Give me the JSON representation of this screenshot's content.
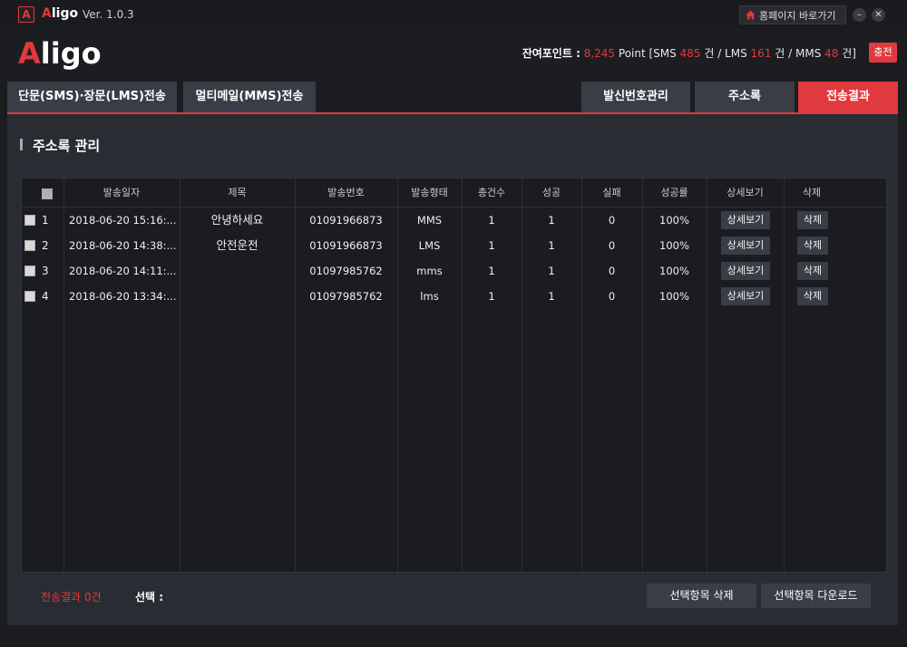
{
  "window": {
    "app_name_a": "A",
    "app_name_rest": "ligo",
    "version": "Ver. 1.0.3",
    "home_label": "홈페이지 바로가기",
    "minimize": "–",
    "close": "✕"
  },
  "header": {
    "logo_a": "A",
    "logo_rest": "ligo",
    "points_label": "잔여포인트 :",
    "points_value": "8,245",
    "points_unit": "Point [SMS",
    "sms_count": "485",
    "sms_unit": "건 / LMS",
    "lms_count": "161",
    "lms_unit": "건 / MMS",
    "mms_count": "48",
    "mms_unit": "건]",
    "charge_label": "충전"
  },
  "tabs": {
    "sms_lms": "단문(SMS)·장문(LMS)전송",
    "mms": "멀티메일(MMS)전송",
    "sender_number": "발신번호관리",
    "address_book": "주소록",
    "send_result": "전송결과"
  },
  "section": {
    "title": "주소록 관리"
  },
  "table": {
    "headers": {
      "date": "발송일자",
      "subject": "제목",
      "number": "발송번호",
      "type": "발송형태",
      "total": "총건수",
      "success": "성공",
      "fail": "실패",
      "rate": "성공률",
      "detail": "상세보기",
      "delete": "삭제"
    },
    "rows": [
      {
        "num": "1",
        "date": "2018-06-20 15:16:...",
        "subject": "안녕하세요",
        "number": "01091966873",
        "type": "MMS",
        "total": "1",
        "success": "1",
        "fail": "0",
        "rate": "100%",
        "detail": "상세보기",
        "delete": "삭제"
      },
      {
        "num": "2",
        "date": "2018-06-20 14:38:...",
        "subject": "안전운전",
        "number": "01091966873",
        "type": "LMS",
        "total": "1",
        "success": "1",
        "fail": "0",
        "rate": "100%",
        "detail": "상세보기",
        "delete": "삭제"
      },
      {
        "num": "3",
        "date": "2018-06-20 14:11:...",
        "subject": "",
        "number": "01097985762",
        "type": "mms",
        "total": "1",
        "success": "1",
        "fail": "0",
        "rate": "100%",
        "detail": "상세보기",
        "delete": "삭제"
      },
      {
        "num": "4",
        "date": "2018-06-20 13:34:...",
        "subject": "",
        "number": "01097985762",
        "type": "lms",
        "total": "1",
        "success": "1",
        "fail": "0",
        "rate": "100%",
        "detail": "상세보기",
        "delete": "삭제"
      }
    ]
  },
  "footer": {
    "result_label": "전송결과 0건",
    "select_label": "선택 :",
    "delete_selected": "선택항목 삭제",
    "download_selected": "선택항목 다운로드"
  },
  "colors": {
    "accent": "#e0393e",
    "tab_bg": "#3a3d45",
    "panel_bg": "#2a2c33",
    "table_bg": "#1b1c21",
    "window_bg": "#1c1d21"
  },
  "icons": {
    "home": "home-icon",
    "app": "aligo-app-icon"
  }
}
